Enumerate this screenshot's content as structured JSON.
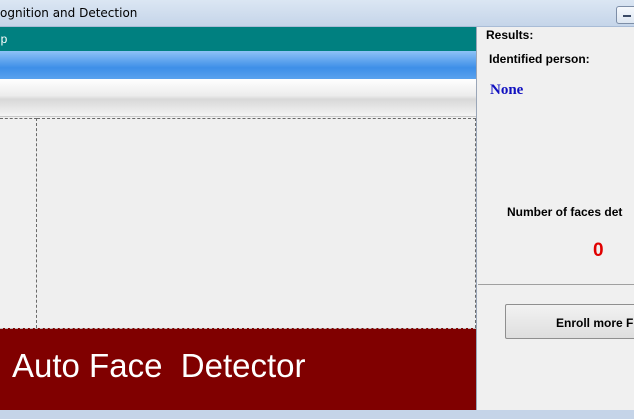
{
  "window": {
    "title": "ognition and Detection"
  },
  "menubar": {
    "menu_partial": "lp"
  },
  "banner": {
    "text": "Auto Face  Detector"
  },
  "results": {
    "group_label": "Results:",
    "identified_label": "Identified person:",
    "identified_value": "None",
    "faces_label": "Number of faces det",
    "faces_value": "0"
  },
  "buttons": {
    "enroll_label": "Enroll more F"
  },
  "colors": {
    "menubar": "#008080",
    "banner": "#800000",
    "name_text": "#1010c0",
    "count_text": "#e00000"
  }
}
